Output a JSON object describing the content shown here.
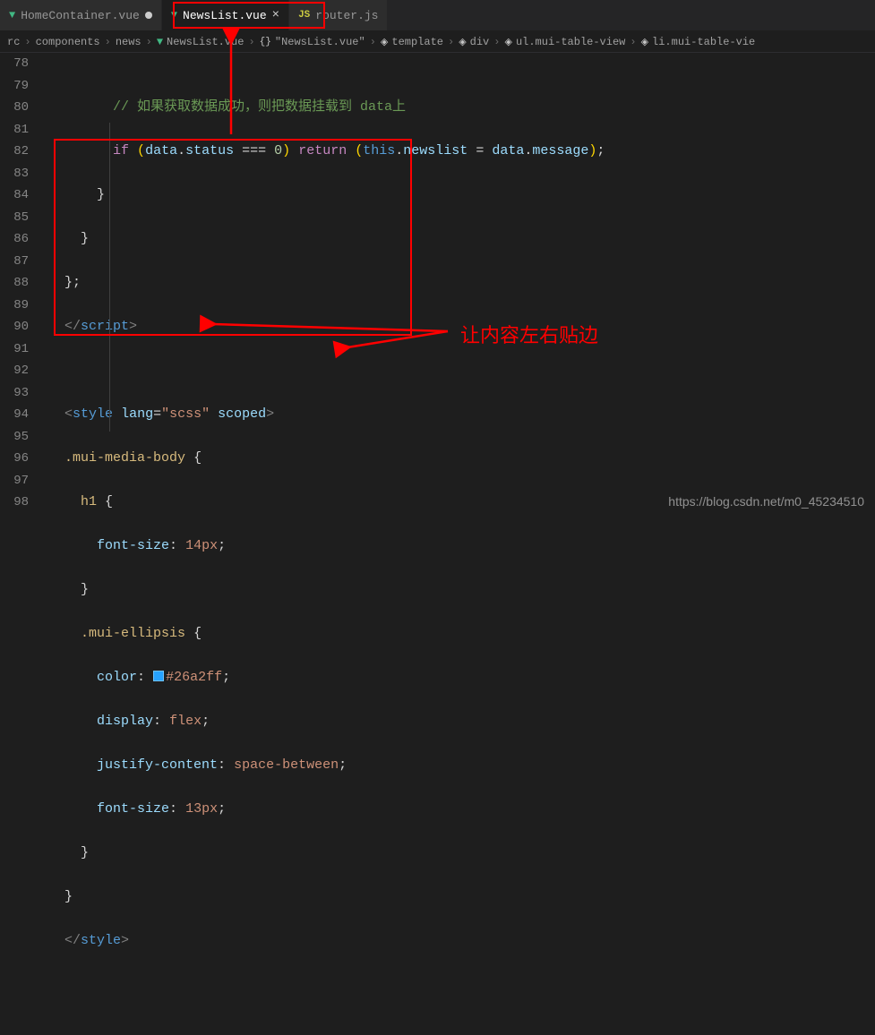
{
  "tabs": [
    {
      "icon": "vue",
      "name": "HomeContainer.vue",
      "dirty": true,
      "closable": false,
      "active": false
    },
    {
      "icon": "vue",
      "name": "NewsList.vue",
      "dirty": false,
      "closable": true,
      "active": true
    },
    {
      "icon": "js",
      "name": "router.js",
      "dirty": false,
      "closable": false,
      "active": false
    }
  ],
  "breadcrumb": {
    "items": [
      {
        "kind": "folder",
        "label": "rc"
      },
      {
        "kind": "folder",
        "label": "components"
      },
      {
        "kind": "folder",
        "label": "news"
      },
      {
        "kind": "vue",
        "label": "NewsList.vue"
      },
      {
        "kind": "brace",
        "label": "\"NewsList.vue\""
      },
      {
        "kind": "tag",
        "label": "template"
      },
      {
        "kind": "tag",
        "label": "div"
      },
      {
        "kind": "tag",
        "label": "ul.mui-table-view"
      },
      {
        "kind": "tag",
        "label": "li.mui-table-vie"
      }
    ]
  },
  "line_start": 78,
  "line_end": 98,
  "code": {
    "l78": "如果获取数据成功，则把数据挂载到 data上",
    "l79a": "if",
    "l79b": "data",
    "l79c": "status",
    "l79d": "===",
    "l79e": "0",
    "l79f": "return",
    "l79g": "this",
    "l79h": "newslist",
    "l79i": "data",
    "l79j": "message",
    "l83a": "script",
    "l85a": "style",
    "l85b": "lang",
    "l85c": "\"scss\"",
    "l85d": "scoped",
    "l86a": ".mui-media-body",
    "l87a": "h1",
    "l88a": "font-size",
    "l88b": "14px",
    "l90a": ".mui-ellipsis",
    "l91a": "color",
    "l91hex": "#26a2ff",
    "l92a": "display",
    "l92b": "flex",
    "l93a": "justify-content",
    "l93b": "space-between",
    "l94a": "font-size",
    "l94b": "13px",
    "l97a": "style"
  },
  "annotation": "让内容左右贴边",
  "watermark": "https://blog.csdn.net/m0_45234510",
  "colors": {
    "swatch": "#26a2ff"
  }
}
